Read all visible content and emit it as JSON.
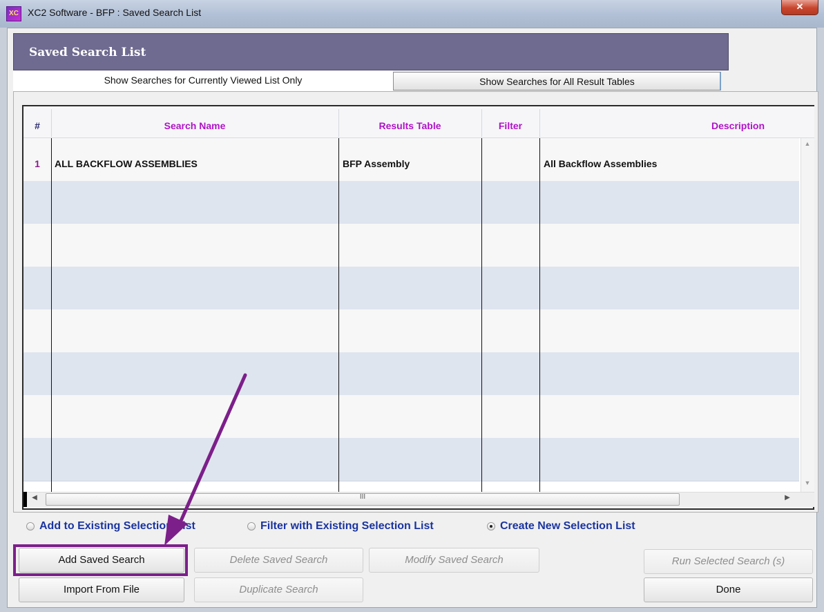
{
  "window": {
    "title": "XC2 Software - BFP : Saved Search List",
    "app_icon_text": "XC",
    "close_glyph": "✕"
  },
  "header": {
    "title": "Saved Search List"
  },
  "tabs": {
    "current": "Show Searches for Currently Viewed List Only",
    "all": "Show Searches for All Result Tables"
  },
  "table": {
    "columns": [
      "#",
      "Search Name",
      "Results Table",
      "Filter",
      "Description"
    ],
    "rows": [
      {
        "num": "1",
        "name": "ALL BACKFLOW ASSEMBLIES",
        "results_table": "BFP Assembly",
        "filter": "",
        "description": "All Backflow Assemblies"
      }
    ],
    "hscroll_grip": "III"
  },
  "options": {
    "add_existing": "Add to Existing Selection List",
    "filter_existing": "Filter with Existing Selection List",
    "create_new": "Create New Selection List",
    "selected": "create_new"
  },
  "buttons": {
    "add_saved_search": "Add Saved Search",
    "delete_saved_search": "Delete Saved Search",
    "modify_saved_search": "Modify Saved Search",
    "run_selected_search": "Run Selected Search (s)",
    "import_from_file": "Import From File",
    "duplicate_search": "Duplicate Search",
    "done": "Done"
  },
  "colors": {
    "header_bg": "#6e6a90",
    "column_header_text": "#b012c8",
    "option_text": "#1a34a0",
    "annotation": "#7c1f8a"
  }
}
